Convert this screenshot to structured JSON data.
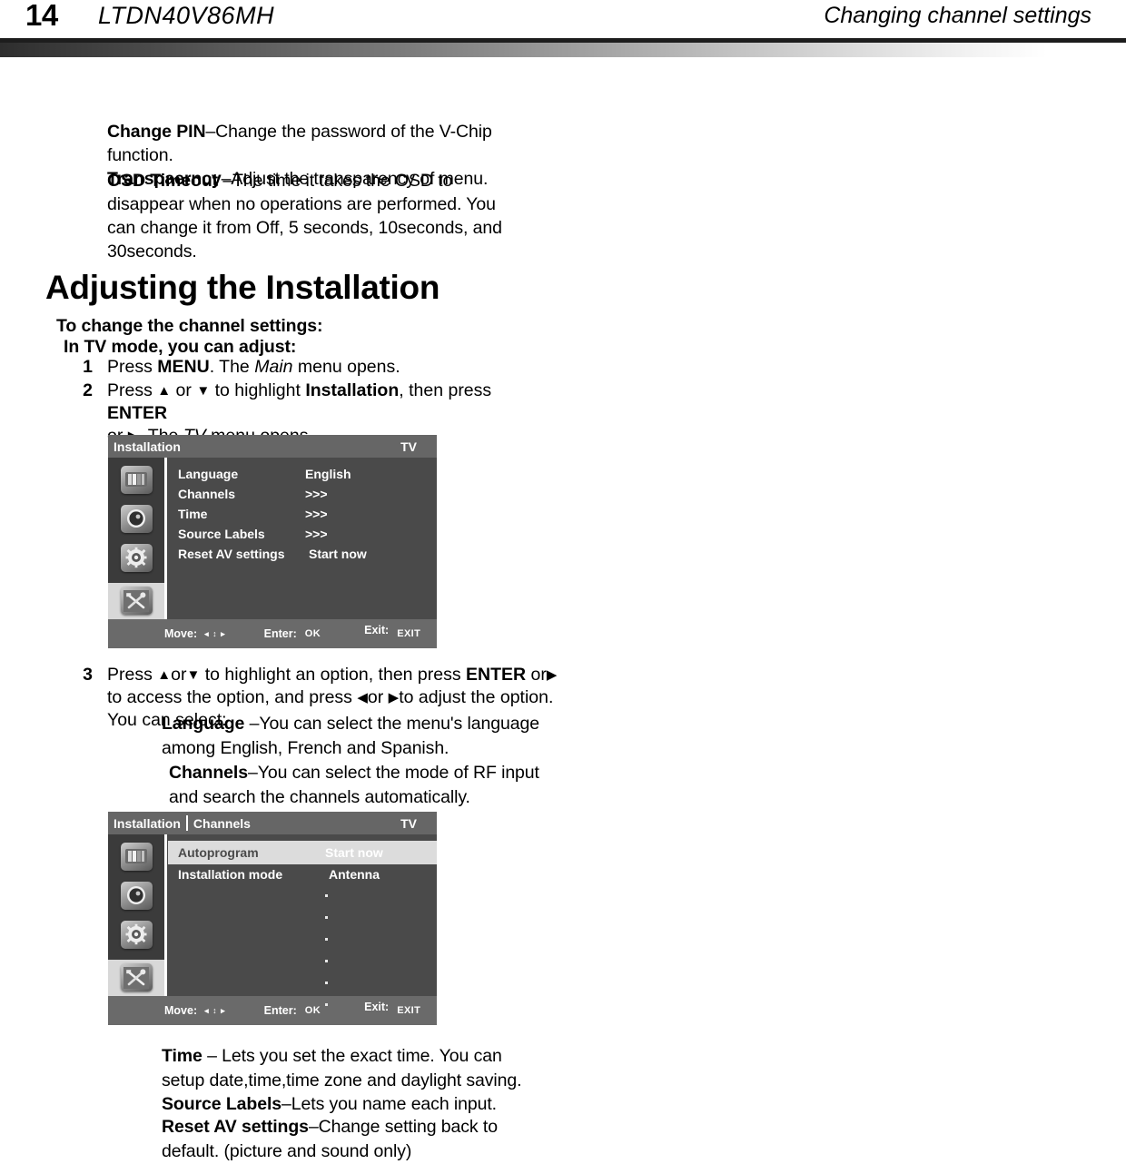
{
  "page_header": {
    "page_number": "14",
    "model": "LTDN40V86MH",
    "section": "Changing channel settings"
  },
  "intro": {
    "change_pin_term": "Change PIN",
    "change_pin_desc": "–Change the password of the V-Chip function.",
    "transparency_term": "Transpaerncy",
    "transparency_desc": "–Adjust the transparency of menu.",
    "osd_timeout_term": "OSD Timeout",
    "osd_timeout_desc": " –The time it takes the OSD to disappear when no operations are performed. You can change it from Off, 5 seconds, 10seconds, and 30seconds."
  },
  "section": {
    "title": "Adjusting the Installation",
    "lead_1": "To change the channel settings:",
    "lead_2": "In TV mode, you can adjust:"
  },
  "steps": {
    "step1": {
      "number": "1",
      "a": "Press ",
      "menu_key": "MENU",
      "b": ". The ",
      "main_italic": "Main",
      "c": " menu opens."
    },
    "step2": {
      "number": "2",
      "a": "Press ",
      "up": "▲",
      "b": " or ",
      "down": "▼",
      "c": " to highlight ",
      "installation": "Installation",
      "d": ", then press ",
      "enter_key": "ENTER",
      "e": "or ",
      "right": "▶",
      "f": ". The ",
      "tv_italic": "TV",
      "g": " menu opens."
    },
    "step3": {
      "number": "3",
      "a": "Press ",
      "up": "▲",
      "b": "or",
      "down": "▼",
      "c": " to highlight an option, then press ",
      "enter_key": "ENTER",
      "d": " or",
      "right": "▶",
      "e": " to access the option, and press ",
      "left": "◀",
      "f": "or ",
      "right2": "▶",
      "g": "to adjust  the option. You can select:"
    }
  },
  "definitions": {
    "language_term": "Language",
    "language_desc": " –You can select the menu's language among English, French and Spanish.",
    "channels_term": "Channels",
    "channels_desc": "–You can select the mode of RF input and search the channels automatically.",
    "time_term": "Time",
    "time_desc": " – Lets you set the exact time. You can setup       date,time,time zone and daylight saving.",
    "source_labels_term": "Source Labels",
    "source_labels_desc": "–Lets you name each input.",
    "reset_av_term": "Reset AV settings",
    "reset_av_desc": "–Change setting back to default. (picture and sound only)"
  },
  "osd_menu_1": {
    "breadcrumb": [
      "Installation"
    ],
    "mode": "TV",
    "sidebar_icons": [
      {
        "name": "picture-icon",
        "selected": false
      },
      {
        "name": "sound-icon",
        "selected": false
      },
      {
        "name": "features-gear-icon",
        "selected": false
      },
      {
        "name": "installation-tools-icon",
        "selected": true
      }
    ],
    "rows": [
      {
        "label": "Language",
        "value": "English"
      },
      {
        "label": "Channels",
        "value": ">>>"
      },
      {
        "label": "Time",
        "value": ">>>"
      },
      {
        "label": "Source Labels",
        "value": ">>>"
      },
      {
        "label": "Reset AV settings",
        "value": "Start now"
      }
    ],
    "footer": {
      "move_label": "Move:",
      "move_glyph": "◂ ↕ ▸",
      "enter_label": "Enter:",
      "enter_key": "OK",
      "exit_label": "Exit:",
      "exit_key": "EXIT"
    }
  },
  "osd_menu_2": {
    "breadcrumb": [
      "Installation",
      "Channels"
    ],
    "mode": "TV",
    "sidebar_icons": [
      {
        "name": "picture-icon",
        "selected": false
      },
      {
        "name": "sound-icon",
        "selected": false
      },
      {
        "name": "features-gear-icon",
        "selected": false
      },
      {
        "name": "installation-tools-icon",
        "selected": true
      }
    ],
    "rows": [
      {
        "label": "Autoprogram",
        "value": "Start now",
        "highlighted": true
      },
      {
        "label": "Installation mode",
        "value": "Antenna",
        "dot": true
      }
    ],
    "empty_dot_rows": 6,
    "footer": {
      "move_label": "Move:",
      "move_glyph": "◂ ↕ ▸",
      "enter_label": "Enter:",
      "enter_key": "OK",
      "exit_label": "Exit:",
      "exit_key": "EXIT"
    }
  },
  "colors": {
    "osd_body": "#4a4a4a",
    "osd_titlebar": "#666666",
    "osd_sidebar": "#3b3b3b",
    "osd_footer": "#6a6a6a",
    "osd_highlight": "#dcdcdc"
  }
}
